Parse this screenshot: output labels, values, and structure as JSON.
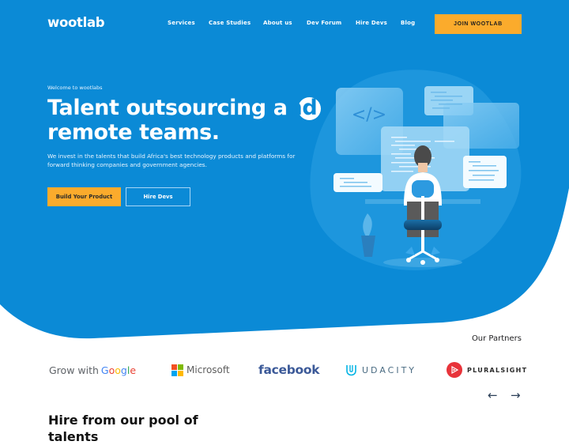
{
  "brand": {
    "name": "wootlab",
    "primary_color": "#0b8ad6",
    "accent_color": "#fbab2c"
  },
  "nav": {
    "links": [
      {
        "label": "Services"
      },
      {
        "label": "Case Studies"
      },
      {
        "label": "About us"
      },
      {
        "label": "Dev Forum"
      },
      {
        "label": "Hire Devs"
      },
      {
        "label": "Blog"
      }
    ],
    "cta_label": "JOIN WOOTLAB"
  },
  "hero": {
    "welcome": "Welcome to wootlabs",
    "headline_line1_prefix": "Talent outsourcing a",
    "headline_line1_highlight": "nd",
    "headline_line2": "remote teams.",
    "subtext": "We invest in the talents that build Africa's best technology products and platforms for forward thinking companies and government agencies.",
    "primary_button": "Build Your Product",
    "secondary_button": "Hire Devs",
    "illustration_icon": "code-brackets-icon",
    "illustration_code_glyph": "</>"
  },
  "partners": {
    "title": "Our Partners",
    "items": [
      {
        "name": "Grow with Google",
        "prefix": "Grow with ",
        "brand": "Google"
      },
      {
        "name": "Microsoft",
        "label": "Microsoft"
      },
      {
        "name": "facebook",
        "label": "facebook"
      },
      {
        "name": "Udacity",
        "label": "UDACITY"
      },
      {
        "name": "Pluralsight",
        "label": "PLURALSIGHT"
      }
    ],
    "prev_arrow": "←",
    "next_arrow": "→"
  },
  "talents_section": {
    "title": "Hire from our pool of talents"
  }
}
